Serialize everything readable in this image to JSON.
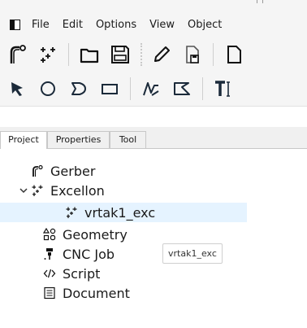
{
  "menubar": {
    "items": [
      "File",
      "Edit",
      "Options",
      "View",
      "Object"
    ]
  },
  "toolbar_top": {
    "icons": [
      "gerber-icon",
      "excellon-icon",
      "open-folder-icon",
      "save-icon",
      "pencil-icon",
      "save-as-icon",
      "new-file-icon"
    ]
  },
  "toolbar_draw": {
    "icons": [
      "select-arrow-icon",
      "circle-icon",
      "arc-icon",
      "rectangle-icon",
      "polyline-icon",
      "polygon-icon",
      "text-tool-icon"
    ]
  },
  "tabs": {
    "project": "Project",
    "properties": "Properties",
    "tool": "Tool",
    "active": "Project"
  },
  "tree": {
    "gerber": "Gerber",
    "excellon": "Excellon",
    "excellon_child": "vrtak1_exc",
    "geometry": "Geometry",
    "cnc_job": "CNC Job",
    "script": "Script",
    "document": "Document"
  },
  "tooltip": {
    "text": "vrtak1_exc"
  },
  "colors": {
    "selection": "#e5f3ff",
    "chrome": "#f5f5f5"
  }
}
